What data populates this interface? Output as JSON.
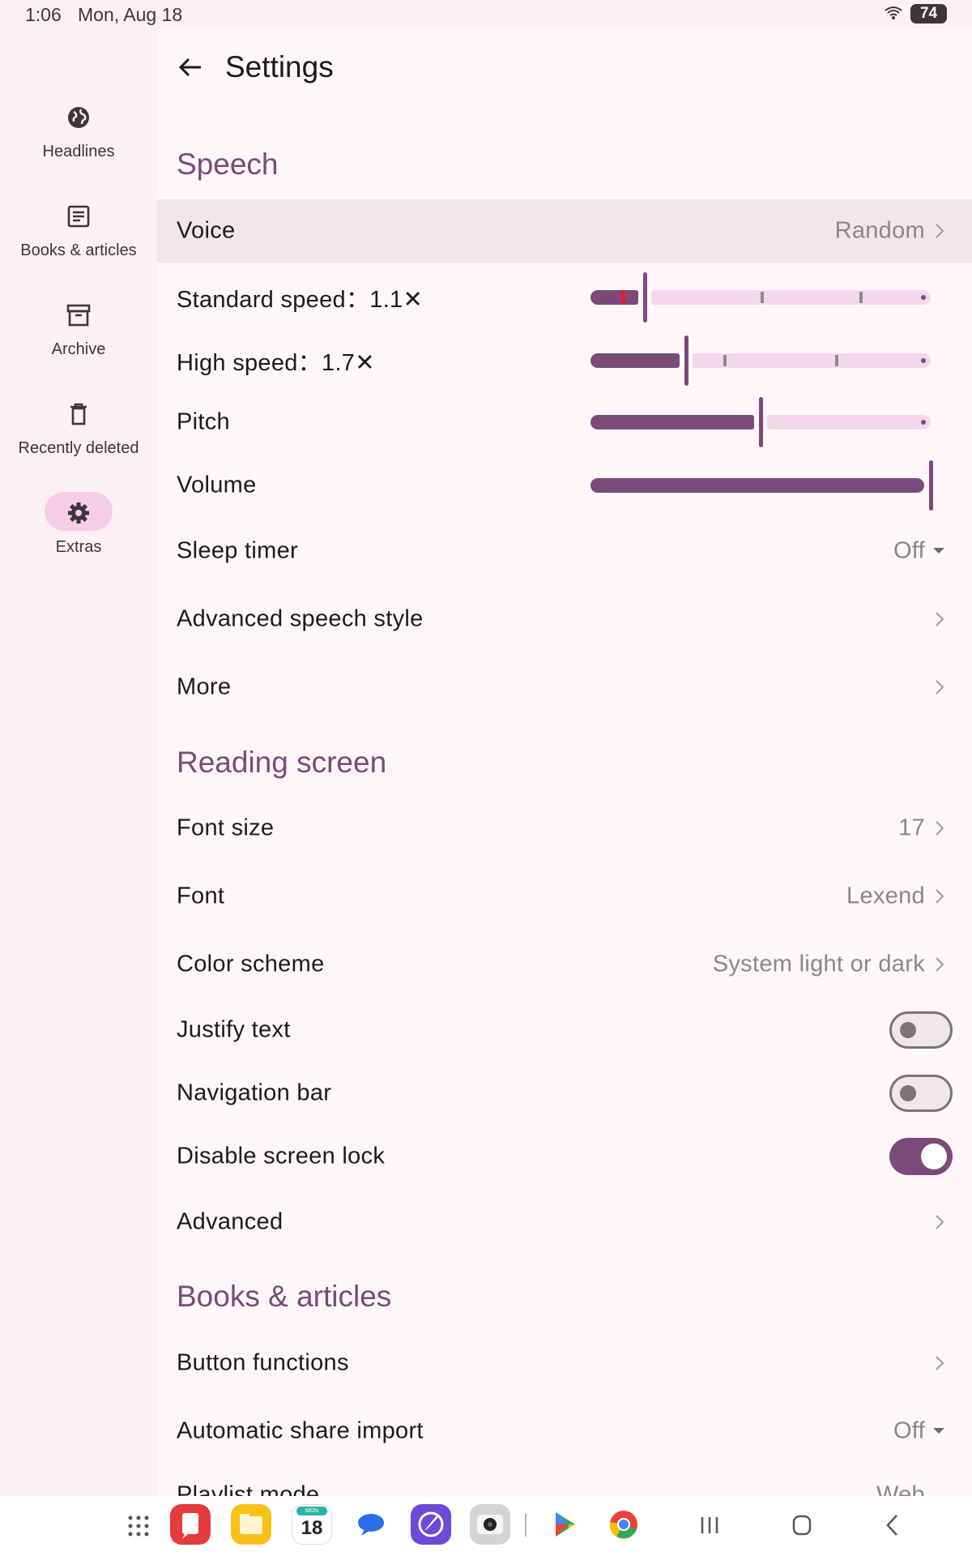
{
  "status": {
    "time": "1:06",
    "date": "Mon, Aug 18",
    "battery": "74"
  },
  "rail": [
    {
      "label": "Headlines",
      "icon": "globe-icon"
    },
    {
      "label": "Books & articles",
      "icon": "article-icon"
    },
    {
      "label": "Archive",
      "icon": "archive-icon"
    },
    {
      "label": "Recently deleted",
      "icon": "trash-icon"
    },
    {
      "label": "Extras",
      "icon": "gear-icon",
      "selected": true
    }
  ],
  "appbar": {
    "title": "Settings"
  },
  "speech": {
    "header": "Speech",
    "voice": {
      "label": "Voice",
      "value": "Random"
    },
    "standard_speed": {
      "label": "Standard speed：1.1✕",
      "level": 0.16
    },
    "high_speed": {
      "label": "High speed：1.7✕",
      "level": 0.28
    },
    "pitch": {
      "label": "Pitch",
      "level": 0.5
    },
    "volume": {
      "label": "Volume",
      "level": 1.0
    },
    "sleep_timer": {
      "label": "Sleep timer",
      "value": "Off"
    },
    "advanced_style": {
      "label": "Advanced speech style"
    },
    "more": {
      "label": "More"
    }
  },
  "reading": {
    "header": "Reading screen",
    "font_size": {
      "label": "Font size",
      "value": "17"
    },
    "font": {
      "label": "Font",
      "value": "Lexend"
    },
    "color_scheme": {
      "label": "Color scheme",
      "value": "System light or dark"
    },
    "justify": {
      "label": "Justify text",
      "on": false
    },
    "navbar": {
      "label": "Navigation bar",
      "on": false
    },
    "screenlock": {
      "label": "Disable screen lock",
      "on": true
    },
    "advanced": {
      "label": "Advanced"
    }
  },
  "books": {
    "header": "Books & articles",
    "button_functions": {
      "label": "Button functions"
    },
    "share_import": {
      "label": "Automatic share import",
      "value": "Off"
    },
    "playlist": {
      "label": "Playlist mode",
      "value": "Web"
    }
  },
  "dock": {
    "calendar_day": "MON",
    "calendar_date": "18"
  },
  "colors": {
    "accent": "#7b4a7a",
    "section": "#7a4a7c",
    "track": "#f4d8ea"
  }
}
